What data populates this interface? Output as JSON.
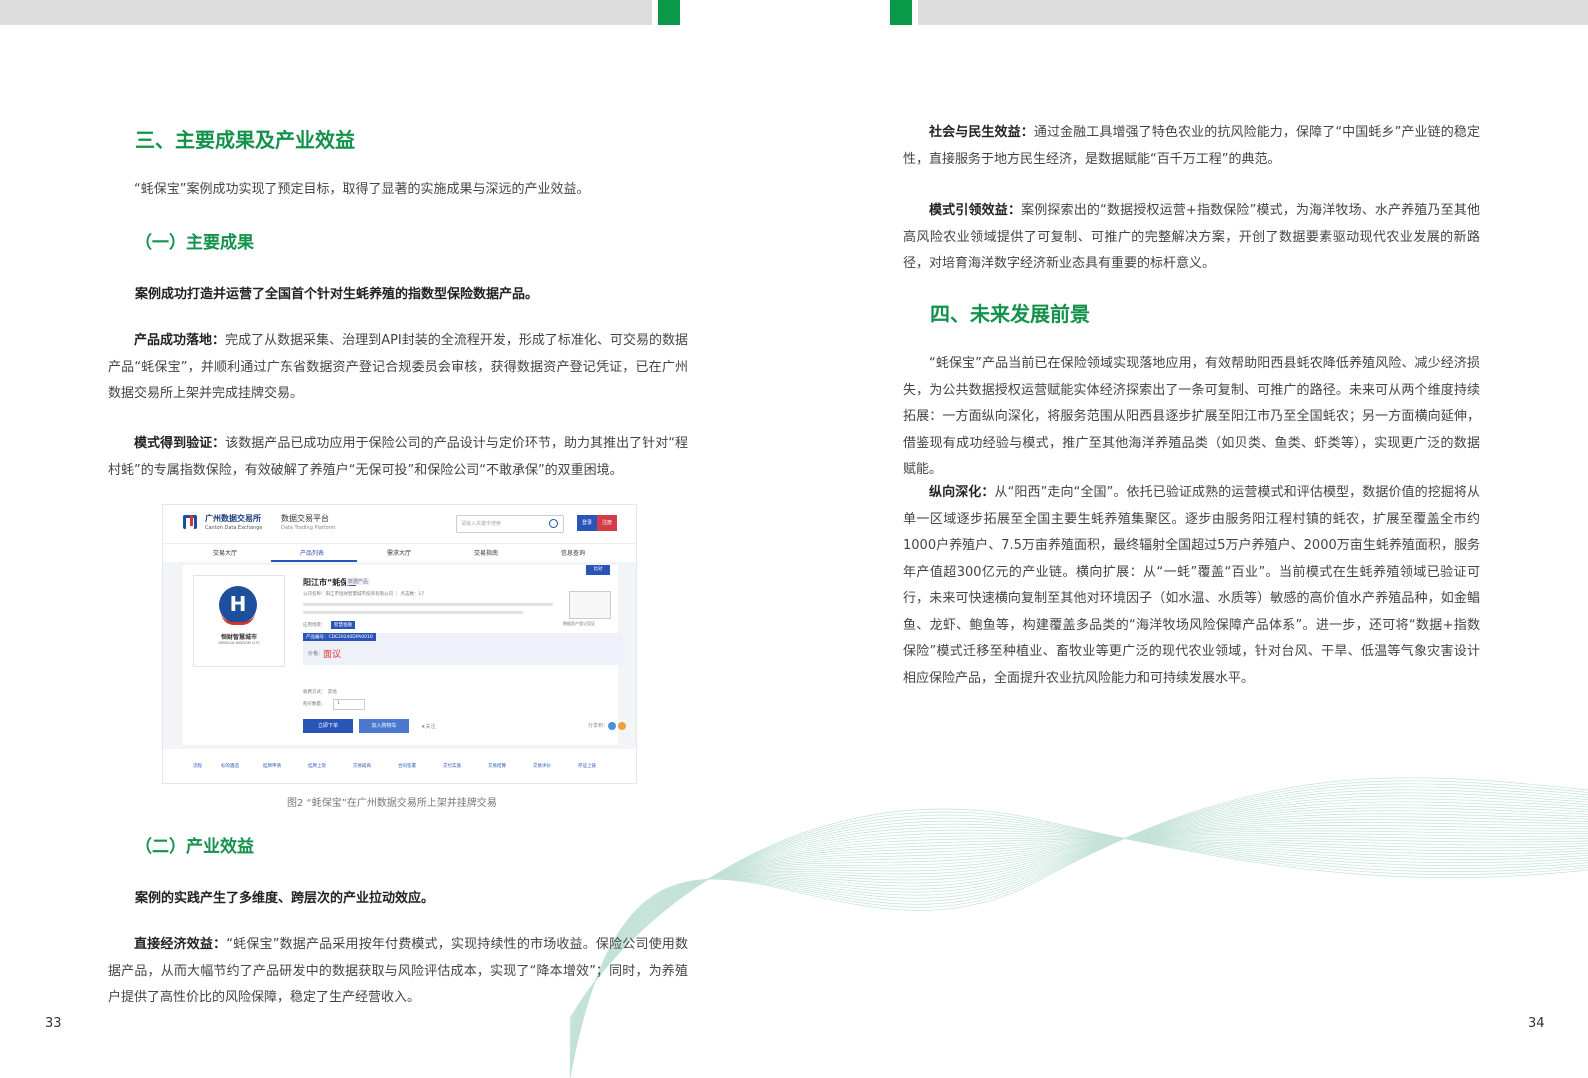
{
  "left_page": {
    "section3_title": "三、主要成果及产业效益",
    "intro": "“蚝保宝”案例成功实现了预定目标，取得了显著的实施成果与深远的产业效益。",
    "sub1_title": "（一）主要成果",
    "sub1_lead": "案例成功打造并运营了全国首个针对生蚝养殖的指数型保险数据产品。",
    "p1_label": "产品成功落地：",
    "p1_text": "完成了从数据采集、治理到API封装的全流程开发，形成了标准化、可交易的数据产品“蚝保宝”，并顺利通过广东省数据资产登记合规委员会审核，获得数据资产登记凭证，已在广州数据交易所上架并完成挂牌交易。",
    "p2_label": "模式得到验证：",
    "p2_text": "该数据产品已成功应用于保险公司的产品设计与定价环节，助力其推出了针对“程村蚝”的专属指数保险，有效破解了养殖户“无保可投”和保险公司“不敢承保”的双重困境。",
    "figure_caption": "图2 “蚝保宝”在广州数据交易所上架并挂牌交易",
    "sub2_title": "（二）产业效益",
    "sub2_lead": "案例的实践产生了多维度、跨层次的产业拉动效应。",
    "p3_label": "直接经济效益：",
    "p3_text": "“蚝保宝”数据产品采用按年付费模式，实现持续性的市场收益。保险公司使用数据产品，从而大幅节约了产品研发中的数据获取与风险评估成本，实现了“降本增效”；同时，为养殖户提供了高性价比的风险保障，稳定了生产经营收入。",
    "page_number": "33"
  },
  "right_page": {
    "p4_label": "社会与民生效益：",
    "p4_text": "通过金融工具增强了特色农业的抗风险能力，保障了“中国蚝乡”产业链的稳定性，直接服务于地方民生经济，是数据赋能“百千万工程”的典范。",
    "p5_label": "模式引领效益：",
    "p5_text": "案例探索出的“数据授权运营+指数保险”模式，为海洋牧场、水产养殖乃至其他高风险农业领域提供了可复制、可推广的完整解决方案，开创了数据要素驱动现代农业发展的新路径，对培育海洋数字经济新业态具有重要的标杆意义。",
    "section4_title": "四、未来发展前景",
    "p6_text": "“蚝保宝”产品当前已在保险领域实现落地应用，有效帮助阳西县蚝农降低养殖风险、减少经济损失，为公共数据授权运营赋能实体经济探索出了一条可复制、可推广的路径。未来可从两个维度持续拓展：一方面纵向深化，将服务范围从阳西县逐步扩展至阳江市乃至全国蚝农；另一方面横向延伸，借鉴现有成功经验与模式，推广至其他海洋养殖品类（如贝类、鱼类、虾类等），实现更广泛的数据赋能。",
    "p7_label": "纵向深化：",
    "p7_text": "从“阳西”走向“全国”。依托已验证成熟的运营模式和评估模型，数据价值的挖掘将从单一区域逐步拓展至全国主要生蚝养殖集聚区。逐步由服务阳江程村镇的蚝农，扩展至覆盖全市约1000户养殖户、7.5万亩养殖面积，最终辐射全国超过5万户养殖户、2000万亩生蚝养殖面积，服务年产值超300亿元的产业链。横向扩展：从“一蚝”覆盖“百业”。当前模式在生蚝养殖领域已验证可行，未来可快速横向复制至其他对环境因子（如水温、水质等）敏感的高价值水产养殖品种，如金鲳鱼、龙虾、鲍鱼等，构建覆盖多品类的“海洋牧场风险保障产品体系”。进一步，还可将“数据+指数保险”模式迁移至种植业、畜牧业等更广泛的现代农业领域，针对台风、干旱、低温等气象灾害设计相应保险产品，全面提升农业抗风险能力和可持续发展水平。",
    "page_number": "34"
  },
  "figure": {
    "brand": "广州数据交易所",
    "brand_en": "Canton Data Exchange",
    "platform": "数据交易平台",
    "platform_en": "Data Trading Platform",
    "search_placeholder": "请输入关键字搜索",
    "login": "登录",
    "register": "注册",
    "nav": [
      "交易大厅",
      "产品列表",
      "需求大厅",
      "交易指南",
      "信息查询"
    ],
    "logo_name": "恒财智慧城市",
    "logo_name_en": "HENGCAI WISDOM CITY",
    "product_title": "阳江市“蚝保宝”",
    "product_tag": "数据产品",
    "company_line": "公司名称：阳江市恒财智慧城市投资有限公司 ｜ 点击数：17",
    "apply_label": "应用场景：",
    "apply_chip": "智慧金融",
    "code_chip": "产品编号：CDE20240DPA0010",
    "price_label": "价格：",
    "price": "面议",
    "delivery": "收费方式：　其他",
    "quantity": "购买数量：",
    "qty_value": "1",
    "buy": "立即下单",
    "cart": "加入购物车",
    "fav": "★关注",
    "share": "分享到：",
    "corner": "比对",
    "cert_label": "数据资产登记凭证",
    "steps": [
      "流程",
      "标的遴选",
      "挂牌申请",
      "挂牌上架",
      "交易磋商",
      "合同签署",
      "交付实施",
      "交易结算",
      "交易评价",
      "存证上链"
    ]
  },
  "colors": {
    "accent_green": "#12924a",
    "bar_gray": "#dcdcdc",
    "bar_green": "#0b9a4a"
  }
}
